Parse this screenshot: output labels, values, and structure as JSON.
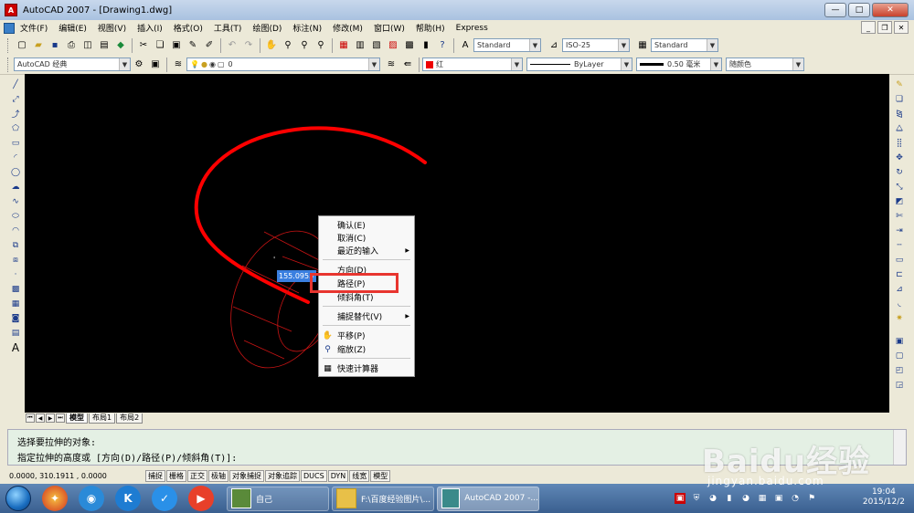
{
  "window": {
    "title": "AutoCAD 2007 - [Drawing1.dwg]",
    "min": "—",
    "max": "□",
    "close": "✕"
  },
  "menubar": {
    "items": [
      "文件(F)",
      "编辑(E)",
      "视图(V)",
      "插入(I)",
      "格式(O)",
      "工具(T)",
      "绘图(D)",
      "标注(N)",
      "修改(M)",
      "窗口(W)",
      "帮助(H)",
      "Express"
    ]
  },
  "toolbar1": {
    "text_style": "Standard",
    "dim_style": "ISO-25",
    "table_style": "Standard"
  },
  "toolbar2": {
    "workspace": "AutoCAD 经典",
    "layer": "0",
    "color": "红",
    "linetype": "ByLayer",
    "lineweight": "0.50 毫米",
    "plotstyle": "随颜色"
  },
  "canvas": {
    "dimension_input": "155.0955",
    "curve_color": "#ff0000",
    "ellipse_color": "#c81414"
  },
  "context_menu": {
    "items": [
      {
        "label": "确认(E)"
      },
      {
        "label": "取消(C)"
      },
      {
        "label": "最近的输入"
      },
      {
        "label": "方向(D)"
      },
      {
        "label": "路径(P)"
      },
      {
        "label": "倾斜角(T)"
      },
      {
        "label": "捕捉替代(V)"
      },
      {
        "label": "平移(P)"
      },
      {
        "label": "缩放(Z)"
      },
      {
        "label": "快速计算器"
      }
    ]
  },
  "layout_tabs": [
    "模型",
    "布局1",
    "布局2"
  ],
  "command": {
    "line1": "选择要拉伸的对象:",
    "line2": "指定拉伸的高度或 [方向(D)/路径(P)/倾斜角(T)]:"
  },
  "status": {
    "coords": "0.0000,   310.1911 , 0.0000",
    "buttons": [
      "捕捉",
      "栅格",
      "正交",
      "极轴",
      "对象捕捉",
      "对象追踪",
      "DUCS",
      "DYN",
      "线宽",
      "模型"
    ]
  },
  "taskbar": {
    "tasks": [
      "自己",
      "F:\\百度经验图片\\...",
      "AutoCAD 2007 -..."
    ],
    "time": "19:04",
    "date": "2015/12/2"
  },
  "watermark": {
    "main": "Baidu经验",
    "sub": "jingyan.baidu.com"
  }
}
